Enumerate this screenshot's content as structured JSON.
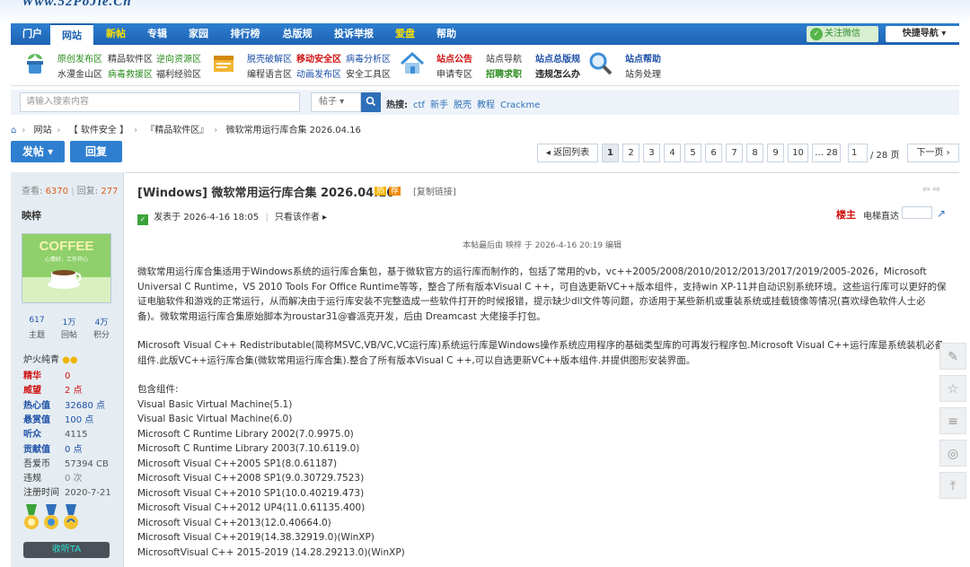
{
  "site": {
    "logo": "Www.52PoJie.Cn"
  },
  "nav": {
    "items": [
      "门户",
      "网站",
      "新帖",
      "专辑",
      "家园",
      "排行榜",
      "总版规",
      "投诉举报",
      "爱盘",
      "帮助"
    ],
    "active_index": 1,
    "yellow_indices": [
      2,
      8
    ],
    "wechat_follow": "关注微信",
    "quick_nav": "快捷导航 ▾"
  },
  "quick_links": {
    "col1": {
      "row1": [
        "原创发布区",
        "精品软件区",
        "逆向资源区"
      ],
      "row2": [
        "水漫金山区",
        "病毒救援区",
        "福利经验区"
      ]
    },
    "col2": {
      "row1": [
        "脱壳破解区",
        "移动安全区",
        "病毒分析区"
      ],
      "row2": [
        "编程语言区",
        "动画发布区",
        "安全工具区"
      ]
    },
    "col3": {
      "row1": [
        "站点公告",
        "站点导航",
        "站点总版规",
        "站点帮助"
      ],
      "row2": [
        "申请专区",
        "招聘求职",
        "违规怎么办",
        "站务处理"
      ]
    }
  },
  "search": {
    "placeholder": "请输入搜索内容",
    "scope": "帖子 ▾",
    "hot_label": "热搜:",
    "hot_terms": [
      "ctf",
      "新手",
      "脱壳",
      "教程",
      "Crackme"
    ]
  },
  "breadcrumb": [
    "网站",
    "【 软件安全 】",
    "『精品软件区』",
    "微软常用运行库合集 2026.04.16"
  ],
  "actions": {
    "post": "发帖 ▾",
    "reply": "回复"
  },
  "pager": {
    "back": "◂ 返回列表",
    "pages": [
      "1",
      "2",
      "3",
      "4",
      "5",
      "6",
      "7",
      "8",
      "9",
      "10",
      "... 28"
    ],
    "current": "1",
    "input_value": "1",
    "total": "/ 28 页",
    "next": "下一页 ›"
  },
  "author": {
    "views_label": "查看:",
    "views": "6370",
    "replies_label": "回复:",
    "replies": "277",
    "name": "映梓",
    "avatar_text": "COFFEE",
    "avatar_sub": "心情好，工作开心",
    "topics": "617",
    "topics_label": "主题",
    "posts": "1万",
    "posts_label": "回帖",
    "points": "4万",
    "points_label": "积分",
    "rank": "炉火纯青",
    "fields": [
      {
        "k": "精华",
        "v": "0",
        "kc": "#d01010",
        "vc": "#d01010"
      },
      {
        "k": "威望",
        "v": "2 点",
        "kc": "#d01010",
        "vc": "#d01010"
      },
      {
        "k": "热心值",
        "v": "32680 点",
        "kc": "#1d4fa8",
        "vc": "#1d4fa8"
      },
      {
        "k": "悬赏值",
        "v": "100 点",
        "kc": "#1d4fa8",
        "vc": "#1d4fa8"
      },
      {
        "k": "听众",
        "v": "4115",
        "kc": "#1d4fa8",
        "vc": "#555"
      },
      {
        "k": "贡献值",
        "v": "0 点",
        "kc": "#1d4fa8",
        "vc": "#1d4fa8"
      },
      {
        "k": "吾爱币",
        "v": "57394 CB",
        "kc": "#333",
        "vc": "#555"
      },
      {
        "k": "违规",
        "v": "0 次",
        "kc": "#333",
        "vc": "#888"
      },
      {
        "k": "注册时间",
        "v": "2020-7-21",
        "kc": "#333",
        "vc": "#555"
      }
    ],
    "button": "收听TA"
  },
  "post": {
    "title": "[Windows] 微软常用运行库合集 2026.04.16",
    "copy_link": "[复制链接]",
    "posted_label": "发表于 2026-4-16 18:05",
    "only_author": "只看该作者 ▸",
    "floor": "楼主",
    "elevator": "电梯直达",
    "edited": "本帖最后由 映梓 于 2026-4-16 20:19 编辑",
    "para1": "微软常用运行库合集适用于Windows系统的运行库合集包，基于微软官方的运行库而制作的，包括了常用的vb，vc++2005/2008/2010/2012/2013/2017/2019/2005-2026，Microsoft Universal C Runtime，VS 2010 Tools For Office Runtime等等，整合了所有版本Visual C ++，可自选更新VC++版本组件，支持win XP-11并自动识别系统环境。这些运行库可以更好的保证电脑软件和游戏的正常运行，从而解决由于运行库安装不完整造成一些软件打开的时候报错，提示缺少dll文件等问题，亦适用于某些新机或重装系统或挂载镜像等情况(喜欢绿色软件人士必备)。微软常用运行库合集原始脚本为roustar31@睿派克开发，后由 Dreamcast 大佬接手打包。",
    "para2": "Microsoft Visual C++ Redistributable(简称MSVC,VB/VC,VC运行库)系统运行库是Windows操作系统应用程序的基础类型库的可再发行程序包.Microsoft Visual C++运行库是系统装机必备组件.此版VC++运行库合集(微软常用运行库合集).整合了所有版本Visual C ++,可以自选更新VC++版本组件.并提供图形安装界面。",
    "components_label": "包含组件:",
    "components": [
      "Visual Basic Virtual Machine(5.1)",
      "Visual Basic Virtual Machine(6.0)",
      "Microsoft C Runtime Library 2002(7.0.9975.0)",
      "Microsoft C Runtime Library 2003(7.10.6119.0)",
      "Microsoft Visual C++2005 SP1(8.0.61187)",
      "Microsoft Visual C++2008 SP1(9.0.30729.7523)",
      "Microsoft Visual C++2010 SP1(10.0.40219.473)",
      "Microsoft Visual C++2012 UP4(11.0.61135.400)",
      "Microsoft Visual C++2013(12.0.40664.0)",
      "Microsoft Visual C++2019(14.38.32919.0)(WinXP)",
      "MicrosoftVisual C++ 2015-2019 (14.28.29213.0)(WinXP)"
    ]
  },
  "colors": {
    "nav": "#2e7fd0",
    "accent_red": "#d01010",
    "accent_blue": "#1d4fa8",
    "side_bg": "#e5edf2"
  }
}
